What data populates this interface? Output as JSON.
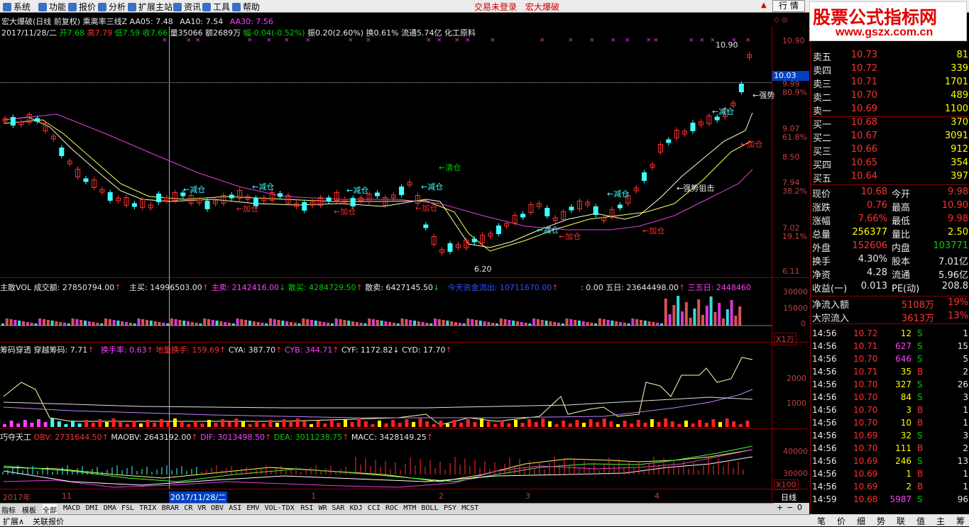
{
  "menu": {
    "items": [
      "系统",
      "功能",
      "报价",
      "分析",
      "扩展主站",
      "资讯",
      "工具",
      "帮助"
    ],
    "login": "交易未登录",
    "app": "宏大爆破",
    "hangqing": "行 情"
  },
  "logo": {
    "line1": "股票公式指标网",
    "line2": "www.gszx.com.cn"
  },
  "header": {
    "line1": {
      "title": "宏大爆破(日线 前复权)",
      "indicator": "乘离率三线Z",
      "aa05": "AA05: 7.48",
      "aa10": "AA10: 7.54",
      "aa30": "AA30: 7.56"
    },
    "line2": {
      "date": "2017/11/28/二",
      "open": "开7.68",
      "high": "高7.79",
      "low": "低7.59",
      "close": "收7.66",
      "vol": "量35066",
      "amt": "额2689万",
      "chg": "幅-0.04(-0.52%)",
      "amp": "振0.20(2.60%)",
      "turn": "换0.61%",
      "float": "流通5.74亿",
      "sector": "化工原料"
    }
  },
  "price_panel": {
    "y_labels": [
      "10.90",
      "9.99",
      "80.9%",
      "9.07",
      "61.8%",
      "8.50",
      "7.94",
      "38.2%",
      "7.02",
      "19.1%",
      "6.11"
    ],
    "current_price_box": "10.03",
    "annotations": {
      "high_marker": "10.90",
      "low_marker": "6.20",
      "qingcang": "←清仓",
      "jiancang": "←减仓",
      "jiacang": "←加仓",
      "qiangshi": "←强势狙击",
      "qiangshi_cut": "←强势"
    }
  },
  "vol_panel": {
    "title": "主散VOL",
    "cje": "成交额: 27850794.00",
    "zhumai": "主买: 14996503.00",
    "zhumai2": "主卖: 2142416.00",
    "sanmai": "散买: 4284729.50",
    "sanmai2": "散卖: 6427145.50",
    "today": "今天资金流出: 10711670.00",
    "five": ": 0.00",
    "wuri": "五日: 23644498.00",
    "sanwu": "三五日: 2448460",
    "y_labels": [
      "30000",
      "15000",
      "0"
    ],
    "unit": "X1万"
  },
  "chip_panel": {
    "title": "筹码穿透",
    "cy": "穿越筹码: 7.71",
    "hsl": "换手率: 0.63",
    "dlhs": "地量换手: 159.69",
    "cya": "CYA: 387.70",
    "cyb": "CYB: 344.71",
    "cyf": "CYF: 1172.82",
    "cyd": "CYD: 17.70",
    "y_labels": [
      "2000",
      "1000"
    ]
  },
  "obv_panel": {
    "title": "巧夺天工",
    "obv": "OBV: 2731644.50",
    "maobv": "MAOBV: 2643192.00",
    "dif": "DIF: 3013498.50",
    "dea": "DEA: 3011238.75",
    "macc": "MACC: 3428149.25",
    "y_labels": [
      "40000",
      "30000"
    ],
    "unit": "X100"
  },
  "xaxis": {
    "labels": [
      "2017年",
      "11",
      "2017/11/28/二",
      "1",
      "2",
      "3",
      "4"
    ],
    "period": "日线"
  },
  "tabs": [
    "指标",
    "模板",
    "全部",
    "MACD",
    "DMI",
    "DMA",
    "FSL",
    "TRIX",
    "BRAR",
    "CR",
    "VR",
    "OBV",
    "ASI",
    "EMV",
    "VOL-TDX",
    "RSI",
    "WR",
    "SAR",
    "KDJ",
    "CCI",
    "ROC",
    "MTM",
    "BOLL",
    "PSY",
    "MCST"
  ],
  "bottom": {
    "expand": "扩展∧",
    "related": "关联报价"
  },
  "orderbook": {
    "sells": [
      {
        "label": "卖五",
        "price": "10.73",
        "vol": "81"
      },
      {
        "label": "卖四",
        "price": "10.72",
        "vol": "339"
      },
      {
        "label": "卖三",
        "price": "10.71",
        "vol": "1701"
      },
      {
        "label": "卖二",
        "price": "10.70",
        "vol": "489"
      },
      {
        "label": "卖一",
        "price": "10.69",
        "vol": "1100"
      }
    ],
    "buys": [
      {
        "label": "买一",
        "price": "10.68",
        "vol": "370"
      },
      {
        "label": "买二",
        "price": "10.67",
        "vol": "3091"
      },
      {
        "label": "买三",
        "price": "10.66",
        "vol": "912"
      },
      {
        "label": "买四",
        "price": "10.65",
        "vol": "354"
      },
      {
        "label": "买五",
        "price": "10.64",
        "vol": "397"
      }
    ]
  },
  "quote": [
    {
      "l1": "现价",
      "v1": "10.68",
      "l2": "今开",
      "v2": "9.98"
    },
    {
      "l1": "涨跌",
      "v1": "0.76",
      "l2": "最高",
      "v2": "10.90"
    },
    {
      "l1": "涨幅",
      "v1": "7.66%",
      "l2": "最低",
      "v2": "9.98"
    },
    {
      "l1": "总量",
      "v1": "256377",
      "l2": "量比",
      "v2": "2.50"
    },
    {
      "l1": "外盘",
      "v1": "152606",
      "l2": "内盘",
      "v2": "103771"
    },
    {
      "l1": "换手",
      "v1": "4.30%",
      "l2": "股本",
      "v2": "7.01亿"
    },
    {
      "l1": "净资",
      "v1": "4.28",
      "l2": "流通",
      "v2": "5.96亿"
    },
    {
      "l1": "收益(一)",
      "v1": "0.013",
      "l2": "PE(动)",
      "v2": "208.8"
    }
  ],
  "flows": [
    {
      "label": "净流入额",
      "v": "5108万",
      "p": "19%"
    },
    {
      "label": "大宗流入",
      "v": "3613万",
      "p": "13%"
    }
  ],
  "ticks": [
    {
      "t": "14:56",
      "p": "10.72",
      "v": "12",
      "s": "S",
      "n": "1"
    },
    {
      "t": "14:56",
      "p": "10.71",
      "v": "627",
      "s": "S",
      "n": "15"
    },
    {
      "t": "14:56",
      "p": "10.70",
      "v": "646",
      "s": "S",
      "n": "5"
    },
    {
      "t": "14:56",
      "p": "10.71",
      "v": "35",
      "s": "B",
      "n": "2"
    },
    {
      "t": "14:56",
      "p": "10.70",
      "v": "327",
      "s": "S",
      "n": "26"
    },
    {
      "t": "14:56",
      "p": "10.70",
      "v": "84",
      "s": "S",
      "n": "3"
    },
    {
      "t": "14:56",
      "p": "10.70",
      "v": "3",
      "s": "B",
      "n": "1"
    },
    {
      "t": "14:56",
      "p": "10.70",
      "v": "10",
      "s": "B",
      "n": "1"
    },
    {
      "t": "14:56",
      "p": "10.69",
      "v": "32",
      "s": "S",
      "n": "3"
    },
    {
      "t": "14:56",
      "p": "10.70",
      "v": "111",
      "s": "B",
      "n": "2"
    },
    {
      "t": "14:56",
      "p": "10.69",
      "v": "246",
      "s": "S",
      "n": "13"
    },
    {
      "t": "14:56",
      "p": "10.69",
      "v": "1",
      "s": "B",
      "n": "1"
    },
    {
      "t": "14:56",
      "p": "10.69",
      "v": "2",
      "s": "B",
      "n": "1"
    },
    {
      "t": "14:59",
      "p": "10.68",
      "v": "5987",
      "s": "S",
      "n": "96"
    }
  ],
  "rtabs": [
    "笔",
    "价",
    "细",
    "势",
    "联",
    "值",
    "主",
    "筹"
  ]
}
